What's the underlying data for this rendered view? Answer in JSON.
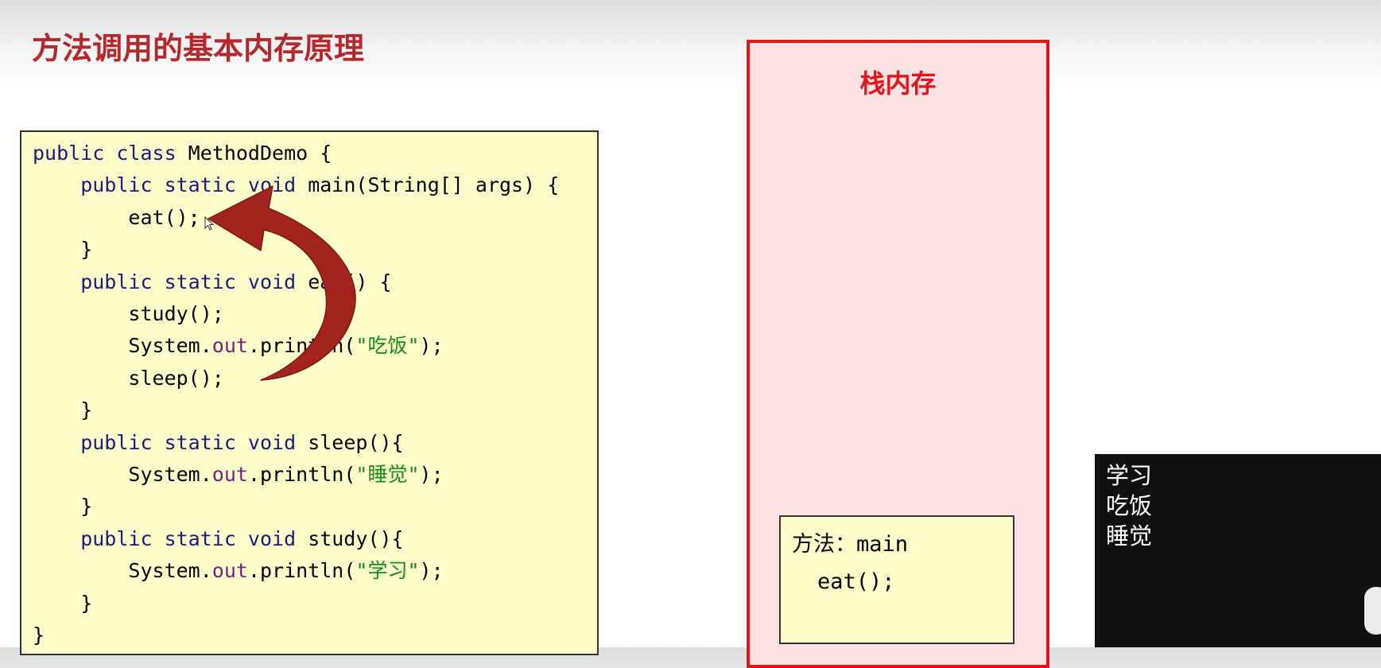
{
  "title": "方法调用的基本内存原理",
  "code": {
    "lines": [
      [
        {
          "t": "public class ",
          "c": "kw"
        },
        {
          "t": "MethodDemo {",
          "c": "plain"
        }
      ],
      [
        {
          "t": "    public static void ",
          "c": "kw"
        },
        {
          "t": "main(String[] args) {",
          "c": "plain"
        }
      ],
      [
        {
          "t": "        eat();",
          "c": "plain"
        }
      ],
      [
        {
          "t": "    }",
          "c": "plain"
        }
      ],
      [
        {
          "t": "    public static void ",
          "c": "kw"
        },
        {
          "t": "eat() {",
          "c": "plain"
        }
      ],
      [
        {
          "t": "        study();",
          "c": "plain"
        }
      ],
      [
        {
          "t": "        System.",
          "c": "plain"
        },
        {
          "t": "out",
          "c": "fld"
        },
        {
          "t": ".println(",
          "c": "plain"
        },
        {
          "t": "\"吃饭\"",
          "c": "str"
        },
        {
          "t": ");",
          "c": "plain"
        }
      ],
      [
        {
          "t": "        sleep();",
          "c": "plain"
        }
      ],
      [
        {
          "t": "    }",
          "c": "plain"
        }
      ],
      [
        {
          "t": "    public static void ",
          "c": "kw"
        },
        {
          "t": "sleep(){",
          "c": "plain"
        }
      ],
      [
        {
          "t": "        System.",
          "c": "plain"
        },
        {
          "t": "out",
          "c": "fld"
        },
        {
          "t": ".println(",
          "c": "plain"
        },
        {
          "t": "\"睡觉\"",
          "c": "str"
        },
        {
          "t": ");",
          "c": "plain"
        }
      ],
      [
        {
          "t": "    }",
          "c": "plain"
        }
      ],
      [
        {
          "t": "    public static void ",
          "c": "kw"
        },
        {
          "t": "study(){",
          "c": "plain"
        }
      ],
      [
        {
          "t": "        System.",
          "c": "plain"
        },
        {
          "t": "out",
          "c": "fld"
        },
        {
          "t": ".println(",
          "c": "plain"
        },
        {
          "t": "\"学习\"",
          "c": "str"
        },
        {
          "t": ");",
          "c": "plain"
        }
      ],
      [
        {
          "t": "    }",
          "c": "plain"
        }
      ],
      [
        {
          "t": "}",
          "c": "plain"
        }
      ]
    ]
  },
  "stack": {
    "title": "栈内存",
    "frame": {
      "header": "方法：main",
      "call": "eat();"
    }
  },
  "console": {
    "lines": [
      "学习",
      "吃饭",
      "睡觉"
    ]
  },
  "colors": {
    "title": "#b5282b",
    "stack_border": "#e5141a",
    "stack_bg": "#fde2e4",
    "code_bg": "#ffffcc",
    "arrow": "#a3231f",
    "console_bg": "#111111"
  },
  "icons": {
    "arrow": "curved-arrow-icon",
    "cursor": "mouse-cursor-icon"
  }
}
